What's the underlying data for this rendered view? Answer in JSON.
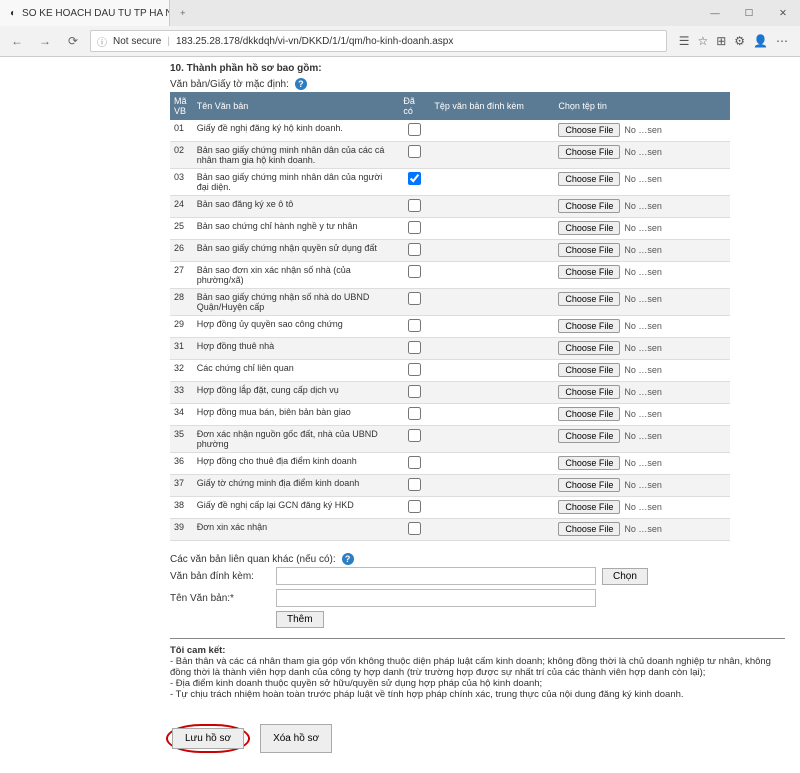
{
  "browser": {
    "tab_title": "SO KE HOACH DAU TU TP HA N",
    "not_secure": "Not secure",
    "url": "183.25.28.178/dkkdqh/vi-vn/DKKD/1/1/qm/ho-kinh-doanh.aspx"
  },
  "section": {
    "title": "10. Thành phần hồ sơ bao gồm:",
    "doc_group_label": "Văn bản/Giấy tờ mặc định:"
  },
  "table": {
    "headers": {
      "ma": "Mã VB",
      "ten": "Tên Văn bản",
      "daco": "Đã có",
      "tep": "Tệp văn bản đính kèm",
      "chon": "Chọn tệp tin"
    },
    "choose_label": "Choose File",
    "file_status": "No …sen",
    "rows": [
      {
        "ma": "01",
        "ten": "Giấy đề nghị đăng ký hộ kinh doanh.",
        "checked": false
      },
      {
        "ma": "02",
        "ten": "Bản sao giấy chứng minh nhân dân của các cá nhân tham gia hộ kinh doanh.",
        "checked": false
      },
      {
        "ma": "03",
        "ten": "Bản sao giấy chứng minh nhân dân của người đại diện.",
        "checked": true
      },
      {
        "ma": "24",
        "ten": "Bản sao đăng ký xe ô tô",
        "checked": false
      },
      {
        "ma": "25",
        "ten": "Bản sao chứng chỉ hành nghề y tư nhân",
        "checked": false
      },
      {
        "ma": "26",
        "ten": "Bản sao giấy chứng nhận quyền sử dụng đất",
        "checked": false
      },
      {
        "ma": "27",
        "ten": "Bản sao đơn xin xác nhận số nhà (của phường/xã)",
        "checked": false
      },
      {
        "ma": "28",
        "ten": "Bản sao giấy chứng nhận số nhà do UBND Quận/Huyện cấp",
        "checked": false
      },
      {
        "ma": "29",
        "ten": "Hợp đồng ủy quyền sao công chứng",
        "checked": false
      },
      {
        "ma": "31",
        "ten": "Hợp đồng thuê nhà",
        "checked": false
      },
      {
        "ma": "32",
        "ten": "Các chứng chỉ liên quan",
        "checked": false
      },
      {
        "ma": "33",
        "ten": "Hợp đồng lắp đặt, cung cấp dịch vụ",
        "checked": false
      },
      {
        "ma": "34",
        "ten": "Hợp đồng mua bán, biên bản bàn giao",
        "checked": false
      },
      {
        "ma": "35",
        "ten": "Đơn xác nhận nguồn gốc đất, nhà của UBND phường",
        "checked": false
      },
      {
        "ma": "36",
        "ten": "Hợp đồng cho thuê địa điểm kinh doanh",
        "checked": false
      },
      {
        "ma": "37",
        "ten": "Giấy tờ chứng minh địa điểm kinh doanh",
        "checked": false
      },
      {
        "ma": "38",
        "ten": "Giấy đề nghị cấp lại GCN đăng ký HKD",
        "checked": false
      },
      {
        "ma": "39",
        "ten": "Đơn xin xác nhận",
        "checked": false
      }
    ]
  },
  "other": {
    "label": "Các văn bản liên quan khác (nếu có):",
    "attach_label": "Văn bản đính kèm:",
    "name_label": "Tên Văn bản:*",
    "choose_btn": "Chọn",
    "add_btn": "Thêm"
  },
  "commit": {
    "title": "Tôi cam kết:",
    "l1": "- Bản thân và các cá nhân tham gia góp vốn không thuộc diện pháp luật cấm kinh doanh; không đồng thời là chủ doanh nghiệp tư nhân, không đồng thời là thành viên hợp danh của công ty hợp danh (trừ trường hợp được sự nhất trí của các thành viên hợp danh còn lại);",
    "l2": "- Địa điểm kinh doanh thuộc quyền sở hữu/quyền sử dụng hợp pháp của hộ kinh doanh;",
    "l3": "- Tự chịu trách nhiệm hoàn toàn trước pháp luật về tính hợp pháp chính xác, trung thực của nội dung đăng ký kinh doanh."
  },
  "actions": {
    "save": "Lưu hồ sơ",
    "delete": "Xóa hồ sơ"
  }
}
